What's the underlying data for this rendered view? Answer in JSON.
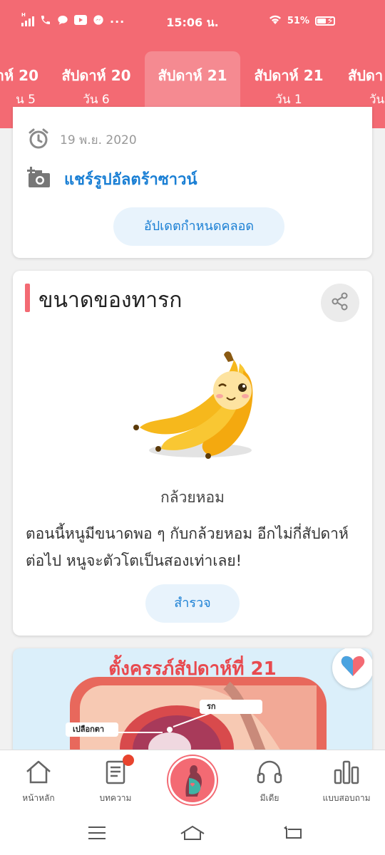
{
  "status_bar": {
    "time": "15:06 น.",
    "battery": "51%",
    "battery_level": 0.51,
    "network_label": "H",
    "left_icons": [
      "signal-icon",
      "phone-icon",
      "chat-icon",
      "youtube-icon",
      "messenger-icon",
      "more-icon"
    ],
    "right_icons": [
      "wifi-icon",
      "battery-icon",
      "charging-icon"
    ]
  },
  "week_tabs": [
    {
      "week": "าห์ 20",
      "day": "น 5"
    },
    {
      "week": "สัปดาห์ 20",
      "day": "วัน 6"
    },
    {
      "week": "สัปดาห์ 21",
      "day": ""
    },
    {
      "week": "สัปดาห์ 21",
      "day": "วัน 1"
    },
    {
      "week": "สัปดา",
      "day": "วัน"
    }
  ],
  "active_tab_index": 2,
  "ultrasound_card": {
    "date": "19 พ.ย. 2020",
    "share_ultrasound": "แชร์รูปอัลตร้าซาวน์",
    "update_due_button": "อัปเดตกำหนดคลอด"
  },
  "baby_size_card": {
    "title": "ขนาดของทารก",
    "fruit_name": "กล้วยหอม",
    "description": "ตอนนี้หนูมีขนาดพอ ๆ กับกล้วยหอม อีกไม่กี่สัปดาห์ต่อไป หนูจะตัวโตเป็นสองเท่าเลย!",
    "explore_button": "สำรวจ"
  },
  "article_card": {
    "title": "ตั้งครรภ์สัปดาห์ที่ 21",
    "labels": [
      "รก",
      "เปลือกตา"
    ]
  },
  "bottom_nav": [
    {
      "label": "หน้าหลัก",
      "icon": "home-icon"
    },
    {
      "label": "บทความ",
      "icon": "article-icon"
    },
    {
      "label": "",
      "icon": "pregnancy-icon"
    },
    {
      "label": "มีเดีย",
      "icon": "headphones-icon"
    },
    {
      "label": "แบบสอบถาม",
      "icon": "bar-chart-icon"
    }
  ],
  "colors": {
    "brand": "#f36a73",
    "link": "#1a7fd4",
    "pill_bg": "#e8f3fc"
  }
}
